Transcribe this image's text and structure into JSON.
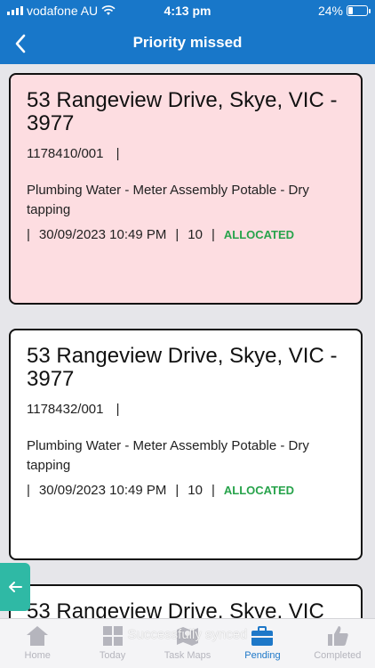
{
  "status_bar": {
    "carrier": "vodafone AU",
    "time": "4:13 pm",
    "battery": "24%",
    "battery_level": 0.24
  },
  "nav": {
    "title": "Priority missed",
    "back_icon": "chevron-left-icon"
  },
  "jobs": [
    {
      "address": "53 Rangeview Drive, Skye, VIC - 3977",
      "job_number": "1178410/001",
      "description": "Plumbing Water - Meter Assembly Potable - Dry tapping",
      "datetime": "30/09/2023 10:49 PM",
      "count": "10",
      "status": "ALLOCATED",
      "highlight": true
    },
    {
      "address": "53 Rangeview Drive, Skye, VIC - 3977",
      "job_number": "1178432/001",
      "description": "Plumbing Water - Meter Assembly Potable - Dry tapping",
      "datetime": "30/09/2023 10:49 PM",
      "count": "10",
      "status": "ALLOCATED",
      "highlight": false
    },
    {
      "address": "53 Rangeview Drive, Skye, VIC"
    }
  ],
  "separator": "|",
  "toast": "Successfully synced",
  "tabs": [
    {
      "label": "Home",
      "icon": "home-icon",
      "active": false
    },
    {
      "label": "Today",
      "icon": "grid-icon",
      "active": false
    },
    {
      "label": "Task Maps",
      "icon": "map-icon",
      "active": false
    },
    {
      "label": "Pending",
      "icon": "briefcase-icon",
      "active": true
    },
    {
      "label": "Completed",
      "icon": "thumbs-up-icon",
      "active": false
    }
  ],
  "colors": {
    "primary": "#1877c9",
    "missed_card": "#fddde1",
    "status_green": "#27a34b",
    "side_tab": "#2fb9a5"
  }
}
